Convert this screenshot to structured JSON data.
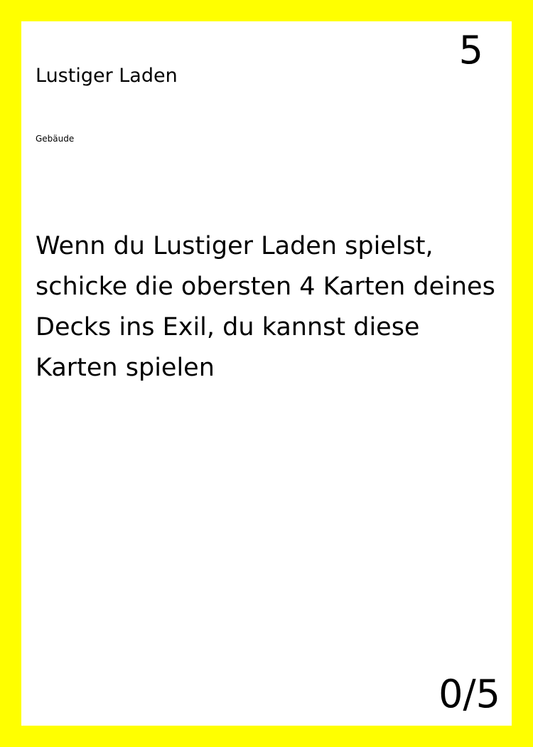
{
  "card": {
    "name": "Lustiger Laden",
    "cost": "5",
    "type": "Gebäude",
    "text": "Wenn du Lustiger Laden spielst, schicke die obersten 4 Karten deines Decks ins Exil, du kannst diese Karten spielen",
    "stats": "0/5"
  },
  "colors": {
    "border": "#ffff00",
    "card_background": "#ffffff",
    "text": "#000000"
  }
}
